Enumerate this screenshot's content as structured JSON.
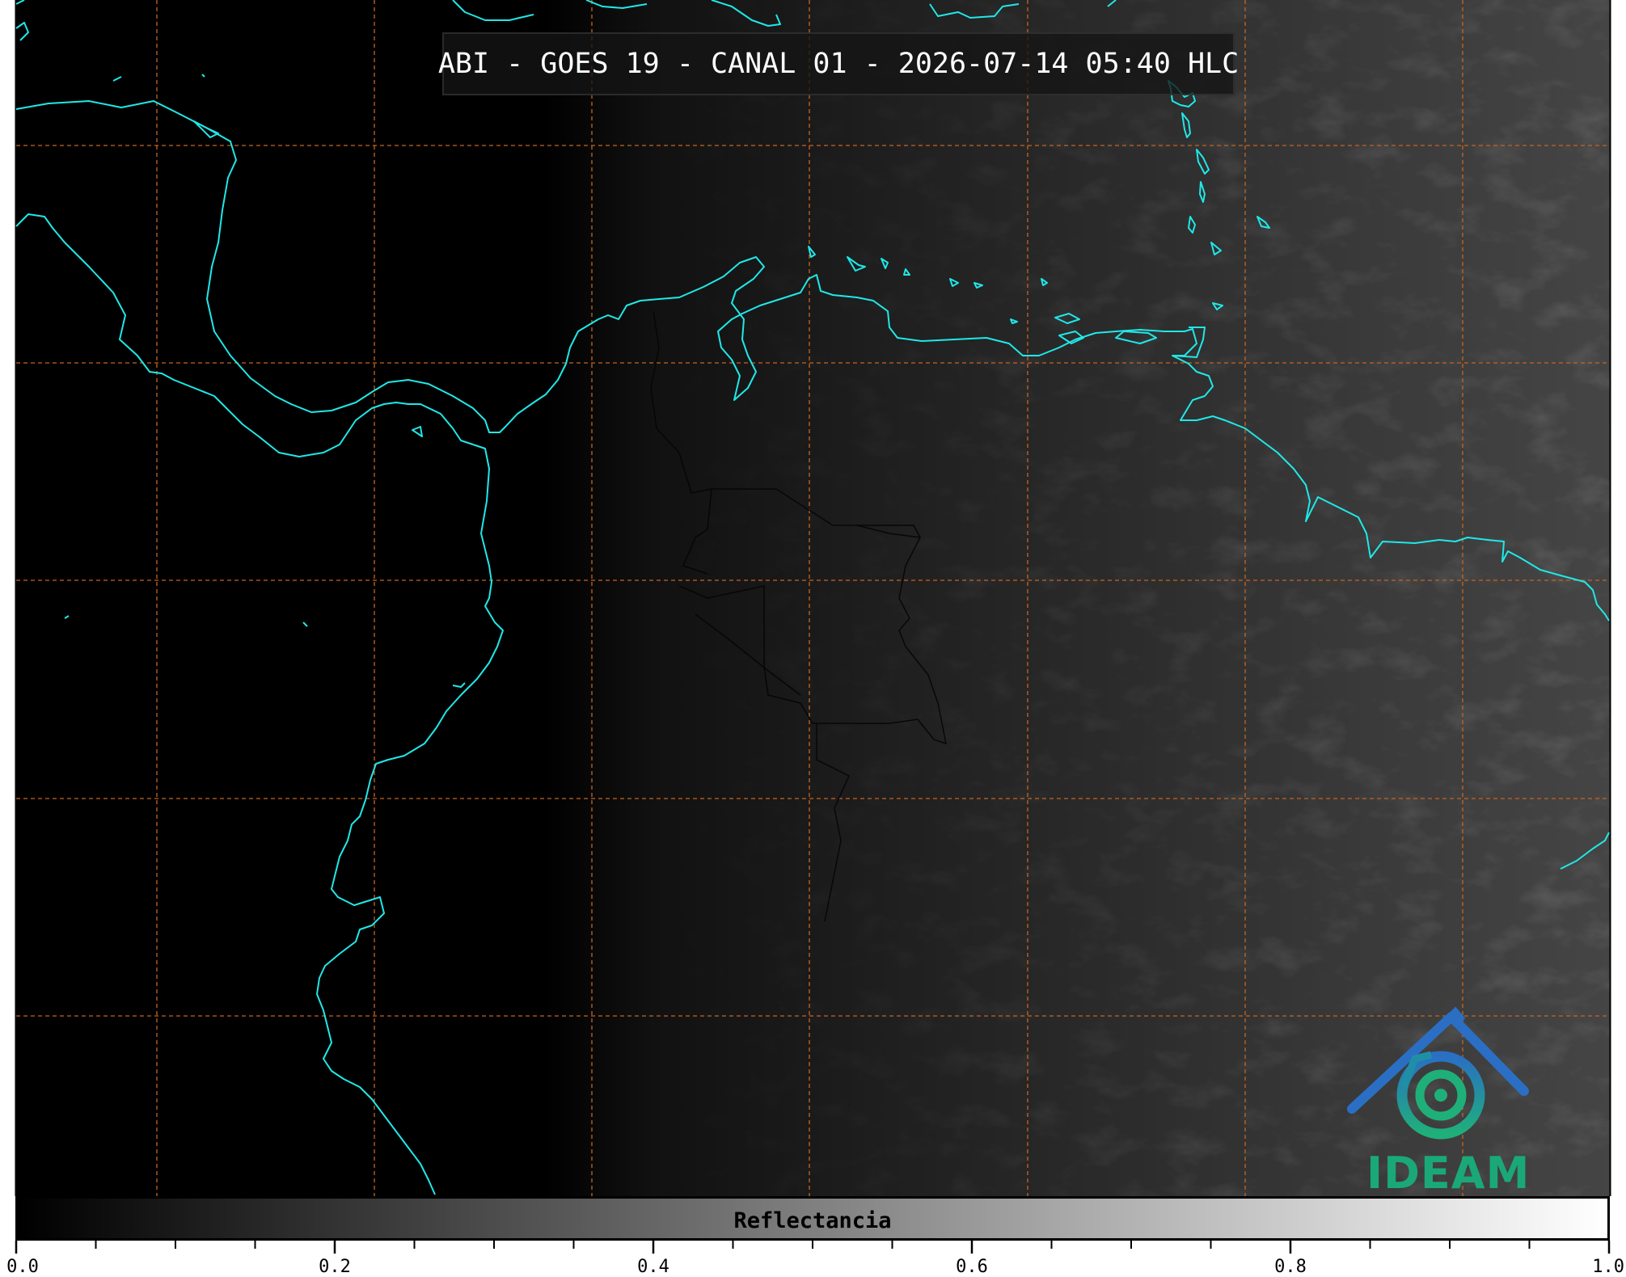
{
  "title": "ABI - GOES 19 - CANAL 01 - 2026-07-14 05:40 HLC",
  "logo": {
    "text": "IDEAM",
    "text_color": "#1aa878",
    "icon": "ideam-logo-icon"
  },
  "colorbar": {
    "label": "Reflectancia",
    "min": 0.0,
    "max": 1.0,
    "tick_labels": [
      "0.0",
      "0.2",
      "0.4",
      "0.6",
      "0.8",
      "1.0"
    ],
    "tick_values": [
      0.0,
      0.2,
      0.4,
      0.6,
      0.8,
      1.0
    ],
    "minor_step": 0.05,
    "colormap": "grayscale"
  },
  "map": {
    "coastline_color": "#20e8e8",
    "gridline_color": "#c8641e",
    "border_color": "#000000",
    "background": "satellite-visible-reflectance"
  }
}
